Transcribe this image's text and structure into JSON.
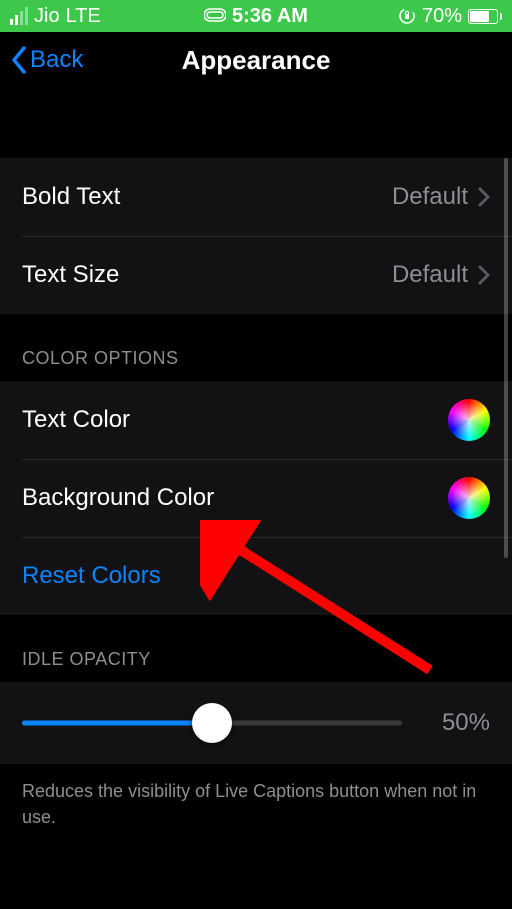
{
  "status": {
    "carrier": "Jio",
    "network": "LTE",
    "time": "5:36 AM",
    "battery_pct": "70%",
    "battery_fill_pct": 70
  },
  "nav": {
    "back_label": "Back",
    "title": "Appearance"
  },
  "text_group": {
    "bold_text_label": "Bold Text",
    "bold_text_value": "Default",
    "text_size_label": "Text Size",
    "text_size_value": "Default"
  },
  "color_options": {
    "header": "COLOR OPTIONS",
    "text_color_label": "Text Color",
    "background_color_label": "Background Color",
    "reset_label": "Reset Colors"
  },
  "idle_opacity": {
    "header": "IDLE OPACITY",
    "value_pct": 50,
    "value_label": "50%",
    "footer": "Reduces the visibility of Live Captions button when not in use."
  },
  "colors": {
    "accent": "#0a84ff",
    "status_bg": "#3dc84b",
    "secondary_text": "#8e8e93"
  }
}
